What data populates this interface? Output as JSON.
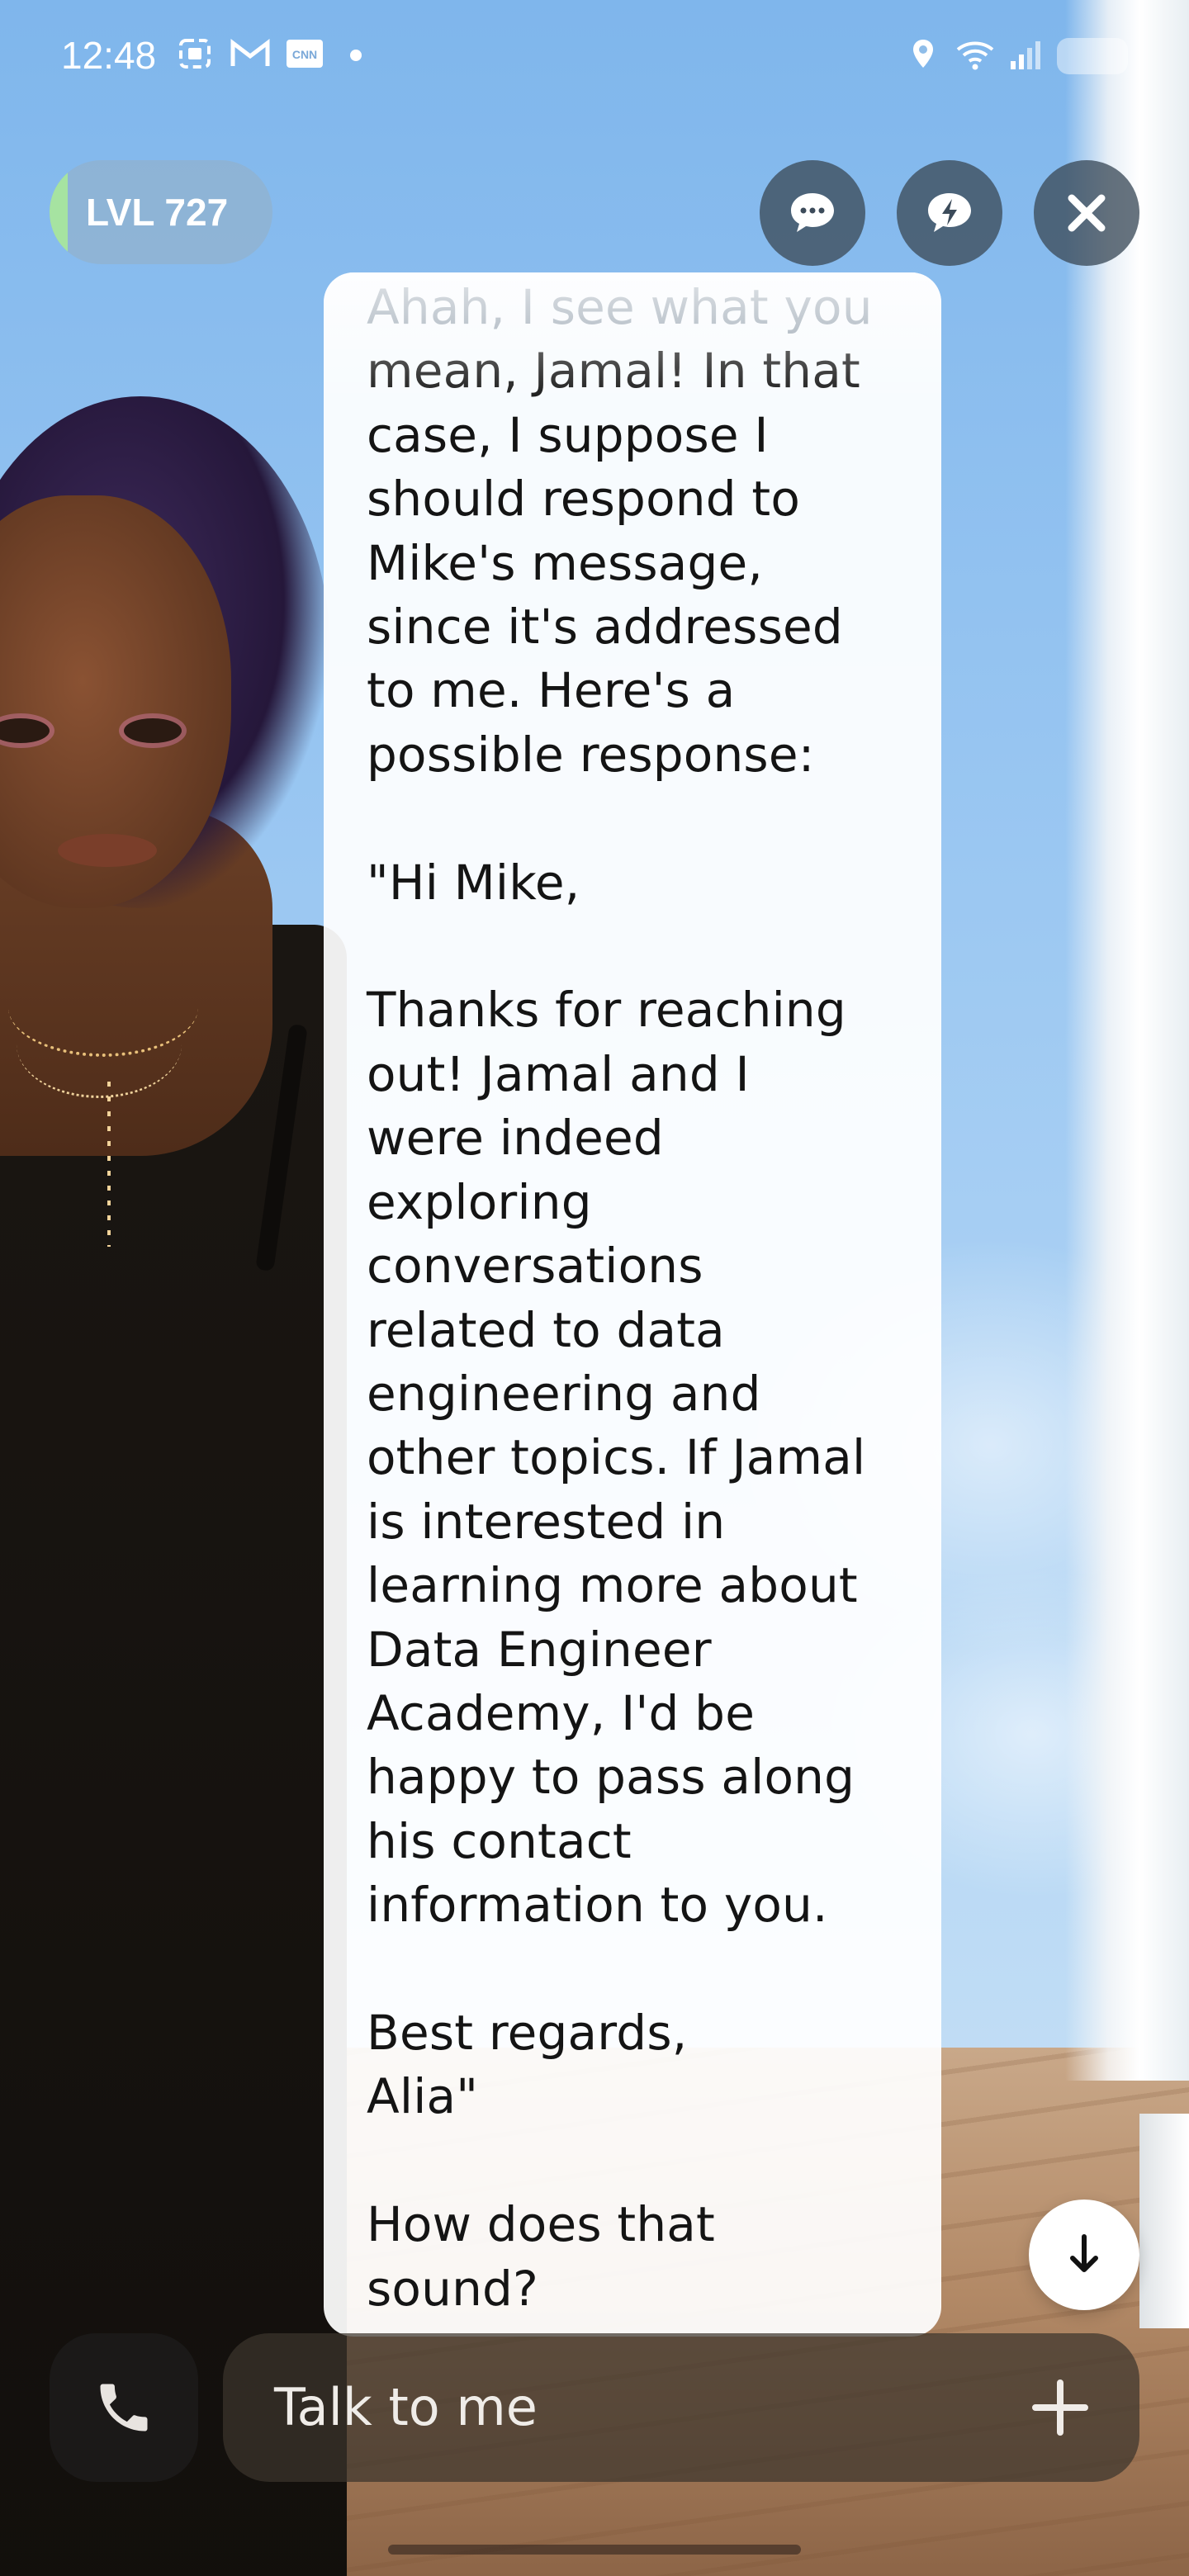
{
  "status_bar": {
    "time": "12:48",
    "left_icons": [
      "screenshot-icon",
      "gmail-icon",
      "cnn-icon",
      "notification-dot"
    ],
    "right_icons": [
      "location-icon",
      "wifi-icon",
      "signal-icon",
      "battery-icon"
    ]
  },
  "header": {
    "level_label": "LVL 727",
    "level_accent_color": "#a6e3a1",
    "buttons": [
      {
        "name": "chat-bubble-button",
        "icon": "chat-ellipsis-icon"
      },
      {
        "name": "quick-reply-button",
        "icon": "lightning-bubble-icon"
      },
      {
        "name": "close-button",
        "icon": "close-icon"
      }
    ]
  },
  "message": {
    "faded_line": "Ahah, I see what you",
    "body": "mean, Jamal! In that\ncase, I suppose I\nshould respond to\nMike's message,\nsince it's addressed\nto me. Here's a\npossible response:\n\n\"Hi Mike,\n\nThanks for reaching\nout! Jamal and I\nwere indeed\nexploring\nconversations\nrelated to data\nengineering and\nother topics. If Jamal\nis interested in\nlearning more about\nData Engineer\nAcademy, I'd be\nhappy to pass along\nhis contact\ninformation to you.\n\nBest regards,\nAlia\"\n\nHow does that\nsound?"
  },
  "scroll_button": {
    "icon": "arrow-down-icon"
  },
  "composer": {
    "placeholder": "Talk to me",
    "call_icon": "phone-icon",
    "add_icon": "plus-icon"
  }
}
